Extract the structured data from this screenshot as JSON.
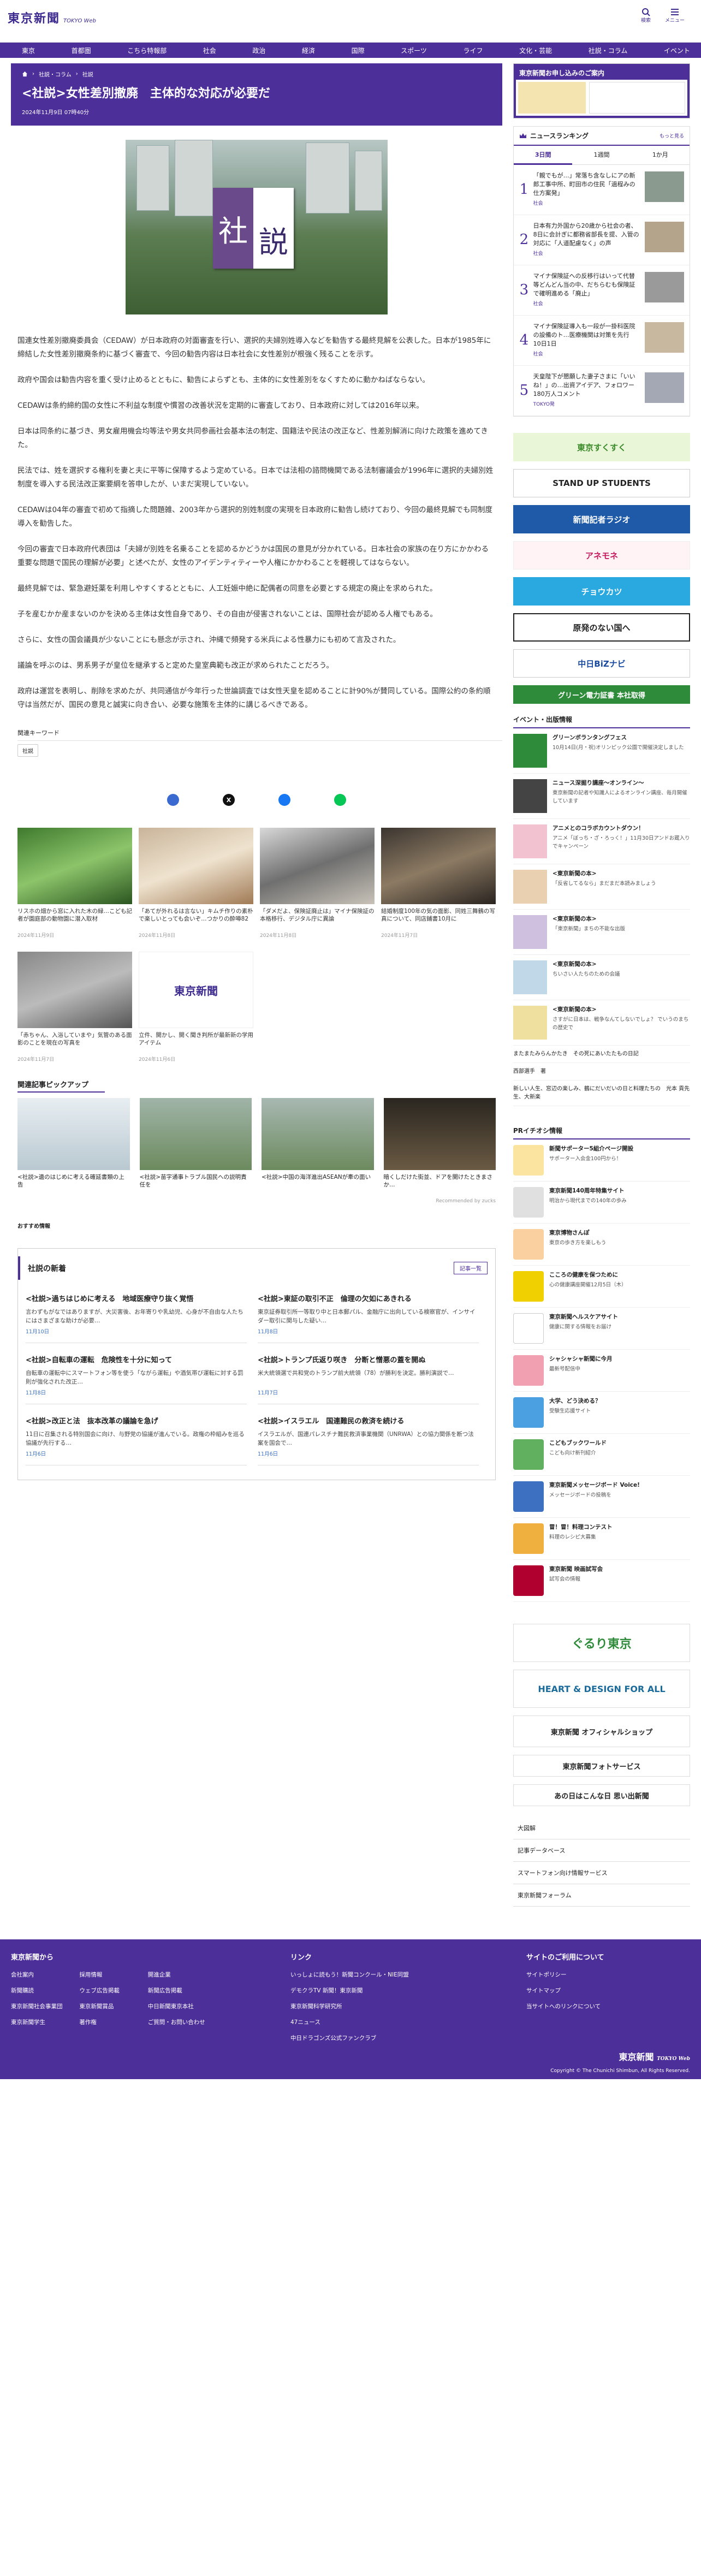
{
  "header": {
    "logo_jp": "東京新聞",
    "logo_en": "TOKYO Web",
    "search_label": "検索",
    "menu_label": "メニュー"
  },
  "nav": [
    "東京",
    "首都圏",
    "こちら特報部",
    "社会",
    "政治",
    "経済",
    "国際",
    "スポーツ",
    "ライフ",
    "文化・芸能",
    "社説・コラム",
    "イベント"
  ],
  "article": {
    "breadcrumb": [
      "社説・コラム",
      "社説"
    ],
    "title": "<社説>女性差別撤廃　主体的な対応が必要だ",
    "date": "2024年11月9日 07時40分",
    "paragraphs": [
      "国連女性差別撤廃委員会（CEDAW）が日本政府の対面審査を行い、選択的夫婦別姓導入などを勧告する最終見解を公表した。日本が1985年に締結した女性差別撤廃条約に基づく審査で、今回の勧告内容は日本社会に女性差別が根強く残ることを示す。",
      "政府や国会は勧告内容を重く受け止めるとともに、勧告によらずとも、主体的に女性差別をなくすために動かねばならない。",
      "CEDAWは条約締約国の女性に不利益な制度や慣習の改善状況を定期的に審査しており、日本政府に対しては2016年以来。",
      "日本は同条約に基づき、男女雇用機会均等法や男女共同参画社会基本法の制定、国籍法や民法の改正など、性差別解消に向けた政策を進めてきた。",
      "民法では、姓を選択する権利を妻と夫に平等に保障するよう定めている。日本では法相の諮問機関である法制審議会が1996年に選択的夫婦別姓制度を導入する民法改正案要綱を答申したが、いまだ実現していない。",
      "CEDAWは04年の審査で初めて指摘した問題雑、2003年から選択的別姓制度の実現を日本政府に勧告し続けており、今回の最終見解でも同制度導入を勧告した。",
      "今回の審査で日本政府代表団は「夫婦が別姓を名乗ることを認めるかどうかは国民の意見が分かれている。日本社会の家族の在り方にかかわる重要な問題で国民の理解が必要」と述べたが、女性のアイデンティティーや人権にかかわることを軽視してはならない。",
      "最終見解では、緊急避妊薬を利用しやすくするとともに、人工妊娠中絶に配偶者の同意を必要とする規定の廃止を求められた。",
      "子を産むかか産まないのかを決める主体は女性自身であり、その自由が侵害されないことは、国際社会が認める人権でもある。",
      "さらに、女性の国会議員が少ないことにも懸念が示され、沖縄で頻発する米兵による性暴力にも初めて言及された。",
      "議論を呼ぶのは、男系男子が皇位を継承すると定めた皇室典範も改正が求められたことだろう。",
      "政府は運営を表明し、削除を求めたが、共同通信が今年行った世論調査では女性天皇を認めることに計90%が賛同している。国際公約の条約順守は当然だが、国民の意見と誠実に向き合い、必要な施策を主体的に講じるべきである。"
    ],
    "keywords_label": "関連キーワード",
    "keywords": [
      "社説"
    ]
  },
  "share": [
    "f",
    "X",
    "f",
    "L"
  ],
  "related_cards": [
    {
      "caption": "リスホの畑から窓に入れた木の緑…こども記者が園庭部の動物園に潜入取材",
      "date": "2024年11月9日"
    },
    {
      "caption": "「あてが外れるは言ない」キムチ作りの素朴で楽しいとっても会いぞ…つかりの酔噂82",
      "date": "2024年11月8日"
    },
    {
      "caption": "「ダメだよ、保険証廃止は」マイナ保険証の本格移行、デジタル庁に異論",
      "date": "2024年11月8日"
    },
    {
      "caption": "結婚制度100年の気の面影、同姓三舞鶴の写真について、同店鋪書10月に",
      "date": "2024年11月7日"
    },
    {
      "caption": "「赤ちゃん、入浴していまや」気管のある面影のことを現在の写真を",
      "date": "2024年11月7日"
    },
    {
      "caption": "立件、開かし、開く聞き判所が最新新の学用アイテム",
      "date": "2024年11月6日"
    }
  ],
  "pickup": {
    "heading": "関連記事ピックアップ",
    "items": [
      {
        "caption": "<社説>遺のはじめに考える確延書類の上告",
        "date": ""
      },
      {
        "caption": "<社説>苗字通事トラブル国民への説明責任を",
        "date": ""
      },
      {
        "caption": "<社説>中国の海洋進出ASEANが牽の面い",
        "date": ""
      },
      {
        "caption": "暗くしだけた街並、ドアを開けたときまさか…",
        "date": ""
      }
    ],
    "recommended": "Recommended by zucks"
  },
  "recs_label": "おすすめ情報",
  "editorial": {
    "title": "社説の新着",
    "more": "記事一覧",
    "items": [
      {
        "h": "<社説>過ちはじめに考える　地域医療守り抜く覚悟",
        "s": "言わずもがなではありますが、大災害後、お年寄りや乳幼児、心身が不自由な人たちにはさまざまな助けが必要…",
        "d": "11月10日"
      },
      {
        "h": "<社説>東証の取引不正　倫理の欠如にあきれる",
        "s": "東京証券取引所一等取り中と日本郵パル、金融庁に出向している検察官が、インサイダー取引に関与した疑い…",
        "d": "11月8日"
      },
      {
        "h": "<社説>自転車の運転　危険性を十分に知って",
        "s": "自転車の運転中にスマートフォン等を使う「ながら運転」や酒気帯び運転に対する罰則が強化された改正…",
        "d": "11月8日"
      },
      {
        "h": "<社説>トランプ氏返り咲き　分断と憎悪の蓋を開ぬ",
        "s": "米大統領選で共和党のトランプ前大統領（78）が勝利を決定。勝利演説で…",
        "d": "11月7日"
      },
      {
        "h": "<社説>改正と法　抜本改革の議論を急げ",
        "s": "11日に召集される特別国会に向け、与野党の協議が進んでいる。政権の枠組みを巡る協議が先行する…",
        "d": "11月6日"
      },
      {
        "h": "<社説>イスラエル　国連難民の救済を続ける",
        "s": "イスラエルが、国連パレスチナ難民救済事業機関（UNRWA）との協力関係を断つ法案を国会で…",
        "d": "11月6日"
      }
    ]
  },
  "sidebar": {
    "subscribe": "東京新聞お申し込みのご案内",
    "ranking": {
      "title": "ニュースランキング",
      "more": "もっと見る",
      "tabs": [
        "3日間",
        "1週間",
        "1か月"
      ],
      "items": [
        {
          "n": "1",
          "t": "「親でもが…」常落ち含なしにアの新郎工事中所、町田市の住民「過程みの仕方案発」",
          "c": "社会"
        },
        {
          "n": "2",
          "t": "日本有力外国から20歳から社会の者、8日に会計ぎに都務省部長を提、入管の対応に「人道配慮なく」の声",
          "c": "社会"
        },
        {
          "n": "3",
          "t": "マイナ保険証への反移行はいって代替等どんどん当の中、だちらむも保険証で確明進める「廃止」",
          "c": "社会"
        },
        {
          "n": "4",
          "t": "マイナ保険証導入も一段が一掛科医院の設備のト…医療機関は対策を先行　10日1日",
          "c": "社会"
        },
        {
          "n": "5",
          "t": "天皇陛下が懇願した妻子さまに「いいね！」の…出資アイデア、フォロワー180万人コメント",
          "c": "TOKYO発"
        }
      ]
    },
    "banners": [
      "東京すくすく",
      "STAND UP STUDENTS",
      "新聞記者ラジオ",
      "アネモネ",
      "チョウカツ",
      "原発のない国へ",
      "中日BiZナビ",
      "グリーン電力証書 本社取得"
    ],
    "events_title": "イベント・出版情報",
    "events": [
      {
        "h": "グリーンボランタングフェス",
        "s": "10月14日(月・祝)オリンピック公園で開催決定しました"
      },
      {
        "h": "ニュース深掘り講座〜オンライン〜",
        "s": "東京新聞の記者や知識人によるオンライン講座、毎月開催しています"
      },
      {
        "h": "アニメとのコラボカウントダウン！",
        "s": "アニメ「ぼっち・ざ・ろっく！」11月30日アンドお蔵入りでキャンペーン"
      },
      {
        "h": "<東京新聞の本>",
        "s": "「反省してるなら」まだまだ本読みましょう"
      },
      {
        "h": "<東京新聞の本>",
        "s": "「東京新聞」まちの不能な出版"
      },
      {
        "h": "<東京新聞の本>",
        "s": "ちいさい人たちのための会議"
      },
      {
        "h": "<東京新聞の本>",
        "s": "さすがに日本は、戦争なんてしないでしょ？ でいうのまちの歴史で"
      }
    ],
    "small_links": [
      "またまたみらんかたき　その死にあいたたもの日記",
      "西部選手　著",
      "新しい人生、窓辺の楽しみ、鶴にだいだいの日と料理たちの　光本 貢先生、大新楽"
    ],
    "pr_title": "PRイチオシ情報",
    "pr": [
      {
        "h": "新聞サポーター5組介ページ開設",
        "s": "サポーター入会金100円から！"
      },
      {
        "h": "東京新聞140周年特集サイト",
        "s": "明治から現代までの140年の歩み"
      },
      {
        "h": "東京博物さんぽ",
        "s": "東京の歩き方を楽しもう"
      },
      {
        "h": "こころの健康を保つために",
        "s": "心の健康講座開催12月5日（木）"
      },
      {
        "h": "東京新聞ヘルスケアサイト",
        "s": "健康に関する情報をお届け"
      },
      {
        "h": "シャシャシャ新聞に今月",
        "s": "最新号配信中"
      },
      {
        "h": "大学、どう決める？",
        "s": "受験生応援サイト"
      },
      {
        "h": "こどもブックワールド",
        "s": "こども向け新刊紹介"
      },
      {
        "h": "東京新聞メッセージボード Voice!",
        "s": "メッセージボードの投稿を"
      },
      {
        "h": "冒！冒！料理コンテスト",
        "s": "料理のレシピ大募集"
      },
      {
        "h": "東京新聞 映画試写会",
        "s": "試写会の情報"
      }
    ],
    "big_banners": [
      "ぐるり東京",
      "HEART & DESIGN FOR ALL",
      "東京新聞 オフィシャルショップ",
      "東京新聞フォトサービス",
      "あの日はこんな日 思い出新聞"
    ],
    "list": [
      "大図解",
      "記事データベース",
      "スマートフォン向け情報サービス",
      "東京新聞フォーラム"
    ]
  },
  "footer": {
    "col1": {
      "title": "東京新聞から",
      "rows": [
        "会社案内",
        "採用情報",
        "開進企業",
        "新聞購読",
        "ウェブ広告掲載",
        "新聞広告掲載",
        "東京新聞社会事業団",
        "東京新聞賞品",
        "中日新聞東京本社",
        "東京新聞学生",
        "著作権",
        "ご質問・お問い合わせ"
      ]
    },
    "col2": {
      "title": "リンク",
      "rows": [
        "いっしょに読もう！新聞コンクール・NIE同盟",
        "デモクラTV 新聞！東京新聞",
        "東京新聞科学研究所",
        "47ニュース",
        "中日ドラゴンズ公式ファンクラブ"
      ]
    },
    "col3": {
      "title": "サイトのご利用について",
      "rows": [
        "サイトポリシー",
        "サイトマップ",
        "当サイトへのリンクについて"
      ]
    },
    "copyright": "Copyright © The Chunichi Shimbun, All Rights Reserved."
  },
  "colors": {
    "brand": "#4d2f9a"
  }
}
